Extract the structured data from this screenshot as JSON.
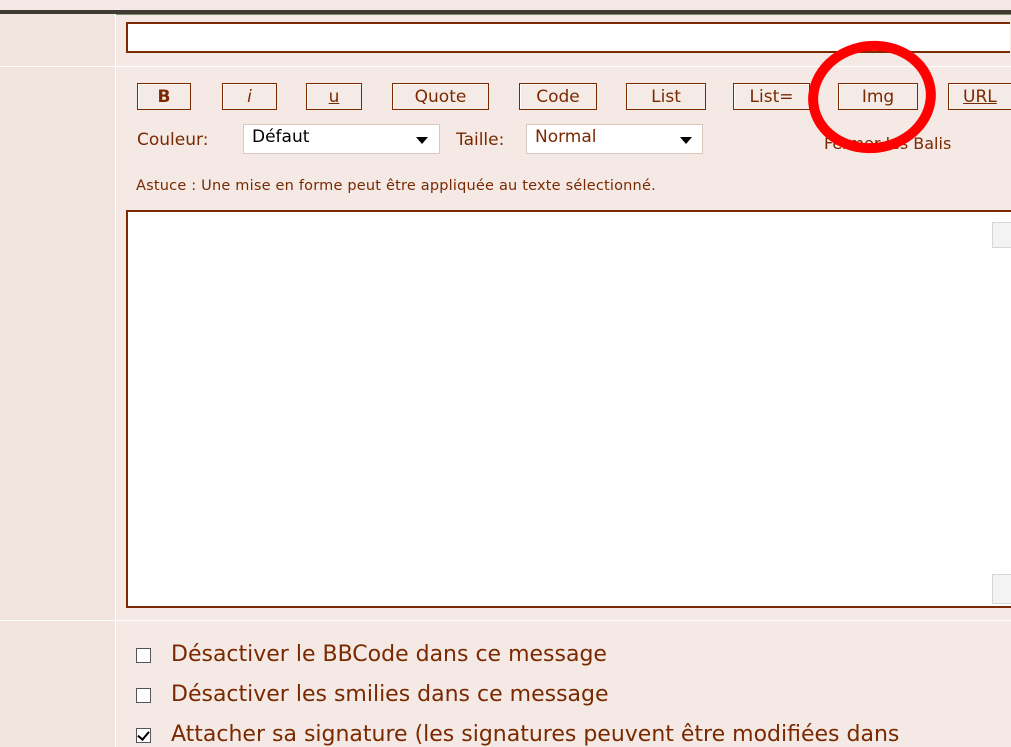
{
  "toolbar": {
    "buttons": [
      "B",
      "i",
      "u",
      "Quote",
      "Code",
      "List",
      "List=",
      "Img",
      "URL"
    ]
  },
  "format": {
    "color_label": "Couleur:",
    "color_value": "Défaut",
    "size_label": "Taille:",
    "size_value": "Normal",
    "close_tags_partial": "Fermer les Balis"
  },
  "tip": "Astuce : Une mise en forme peut être appliquée au texte sélectionné.",
  "options": [
    {
      "label": "Désactiver le BBCode dans ce message",
      "checked": false
    },
    {
      "label": "Désactiver les smilies dans ce message",
      "checked": false
    },
    {
      "label": "Attacher sa signature (les signatures peuvent être modifiées dans",
      "checked": true
    }
  ],
  "colors": {
    "accent": "#7a2900",
    "background": "#f4e9e4",
    "highlight_circle": "#ff0000"
  }
}
